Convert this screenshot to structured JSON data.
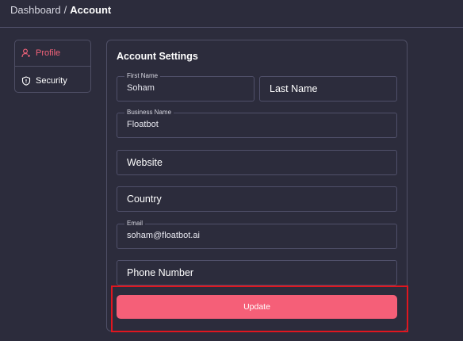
{
  "breadcrumb": {
    "parent": "Dashboard",
    "separator": "/",
    "current": "Account"
  },
  "side_menu": {
    "items": [
      {
        "label": "Profile",
        "icon": "user-icon",
        "active": true
      },
      {
        "label": "Security",
        "icon": "shield-icon",
        "active": false
      }
    ]
  },
  "form": {
    "title": "Account Settings",
    "first_name": {
      "label": "First Name",
      "value": "Soham"
    },
    "last_name": {
      "placeholder": "Last Name"
    },
    "business_name": {
      "label": "Business Name",
      "value": "Floatbot"
    },
    "website": {
      "placeholder": "Website"
    },
    "country": {
      "placeholder": "Country"
    },
    "email": {
      "label": "Email",
      "value": "soham@floatbot.ai"
    },
    "phone": {
      "placeholder": "Phone Number"
    },
    "submit_label": "Update"
  },
  "colors": {
    "background": "#2c2c3c",
    "accent": "#f55f78",
    "active_item": "#f2637a",
    "highlight_border": "#e0161f"
  }
}
